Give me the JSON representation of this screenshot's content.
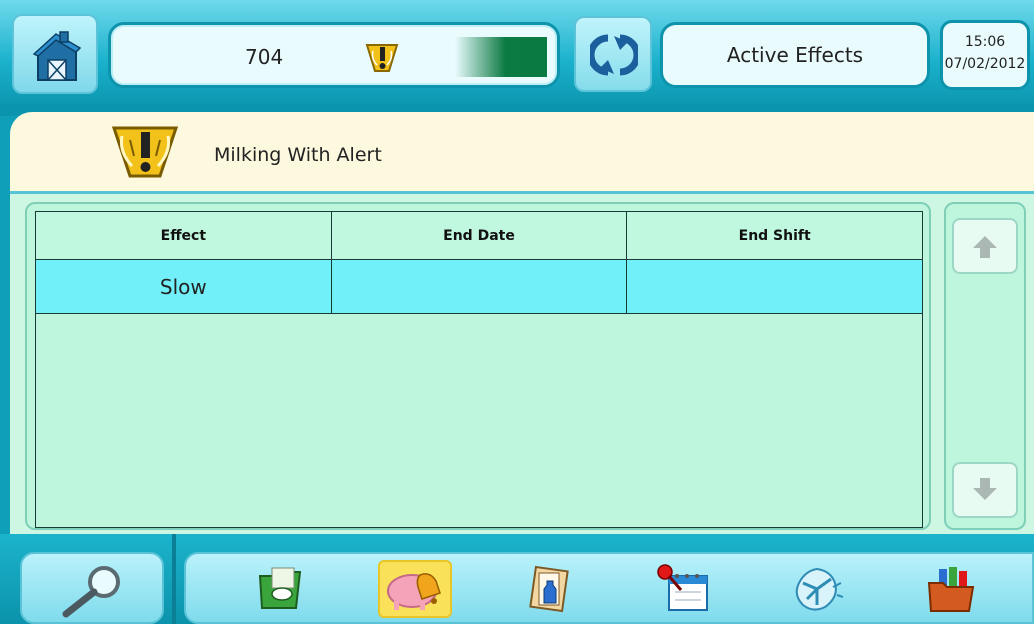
{
  "header": {
    "cow_number": "704",
    "screen_title": "Active Effects",
    "time": "15:06",
    "date": "07/02/2012"
  },
  "alert": {
    "title": "Milking With Alert"
  },
  "table": {
    "columns": [
      "Effect",
      "End Date",
      "End Shift"
    ],
    "rows": [
      [
        "Slow",
        "",
        ""
      ]
    ]
  },
  "icons": {
    "home": "barn-icon",
    "sync": "sync-arrows-icon",
    "alert": "milking-alert-icon",
    "search": "magnifier-icon",
    "nav": [
      "cow-report-icon",
      "heat-bell-icon",
      "milk-test-icon",
      "calendar-pin-icon",
      "network-icon",
      "folders-icon"
    ]
  },
  "colors": {
    "accent": "#0e93ac",
    "row_highlight": "#71f0f9",
    "content_bg": "#bdf6dd",
    "indicator_green": "#0b7a43",
    "active_nav": "#f9e25a"
  }
}
